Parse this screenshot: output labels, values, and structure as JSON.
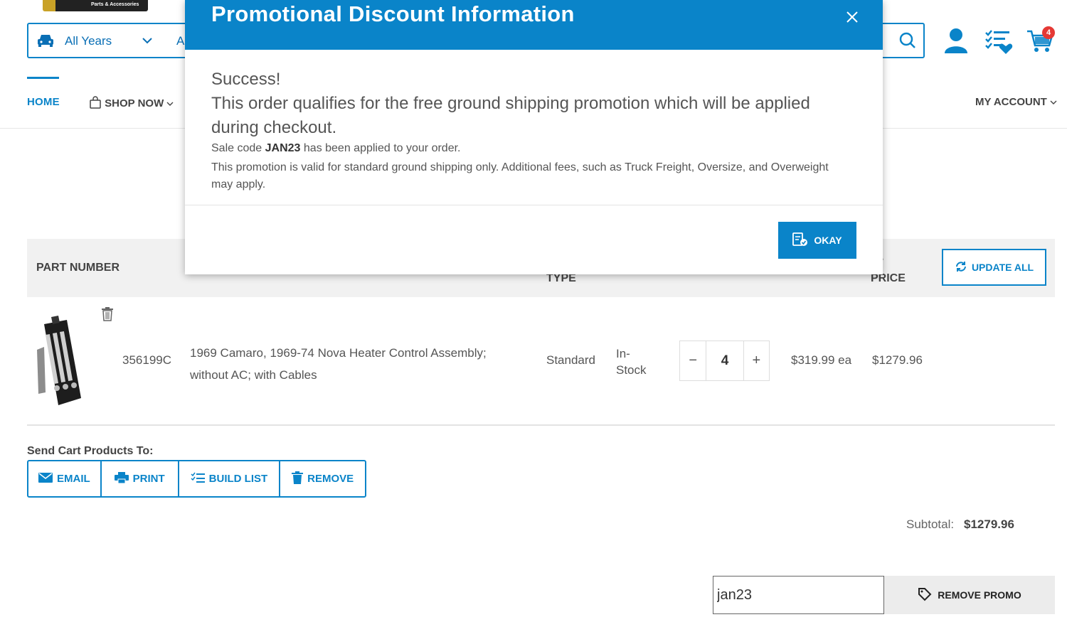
{
  "header": {
    "logo_tagline": "Parts & Accessories",
    "vehicle_selector": {
      "year_label": "All Years",
      "next_field_stub": "A"
    },
    "cart_count": "4"
  },
  "nav": {
    "home": "HOME",
    "shop_now": "SHOP NOW",
    "my_account": "MY ACCOUNT"
  },
  "table": {
    "headers": {
      "part_number": "PART NUMBER",
      "type": "TYPE",
      "ext": "T.",
      "price": "PRICE"
    },
    "update_all": "UPDATE ALL",
    "rows": [
      {
        "part_number": "356199C",
        "description": "1969 Camaro, 1969-74 Nova Heater Control Assembly; without AC; with Cables",
        "type": "Standard",
        "stock": "In-Stock",
        "quantity": "4",
        "unit_price": "$319.99 ea",
        "ext_price": "$1279.96"
      }
    ]
  },
  "send_cart": {
    "label": "Send Cart Products To:",
    "buttons": {
      "email": "EMAIL",
      "print": "PRINT",
      "build_list": "BUILD LIST",
      "remove": "REMOVE"
    }
  },
  "summary": {
    "subtotal_label": "Subtotal:",
    "subtotal_value": "$1279.96"
  },
  "promo": {
    "code_value": "jan23",
    "remove_button": "REMOVE PROMO"
  },
  "modal": {
    "title": "Promotional Discount Information",
    "success": "Success!",
    "qualifies": "This order qualifies for the free ground shipping promotion which will be applied during checkout.",
    "sale_prefix": "Sale code",
    "sale_code": "JAN23",
    "sale_suffix": "has been applied to your order.",
    "validity": "This promotion is valid for standard ground shipping only. Additional fees, such as Truck Freight, Oversize, and Overweight may apply.",
    "okay_button": "OKAY"
  },
  "colors": {
    "brand_blue": "#0a84c9",
    "badge_red": "#e53935"
  }
}
